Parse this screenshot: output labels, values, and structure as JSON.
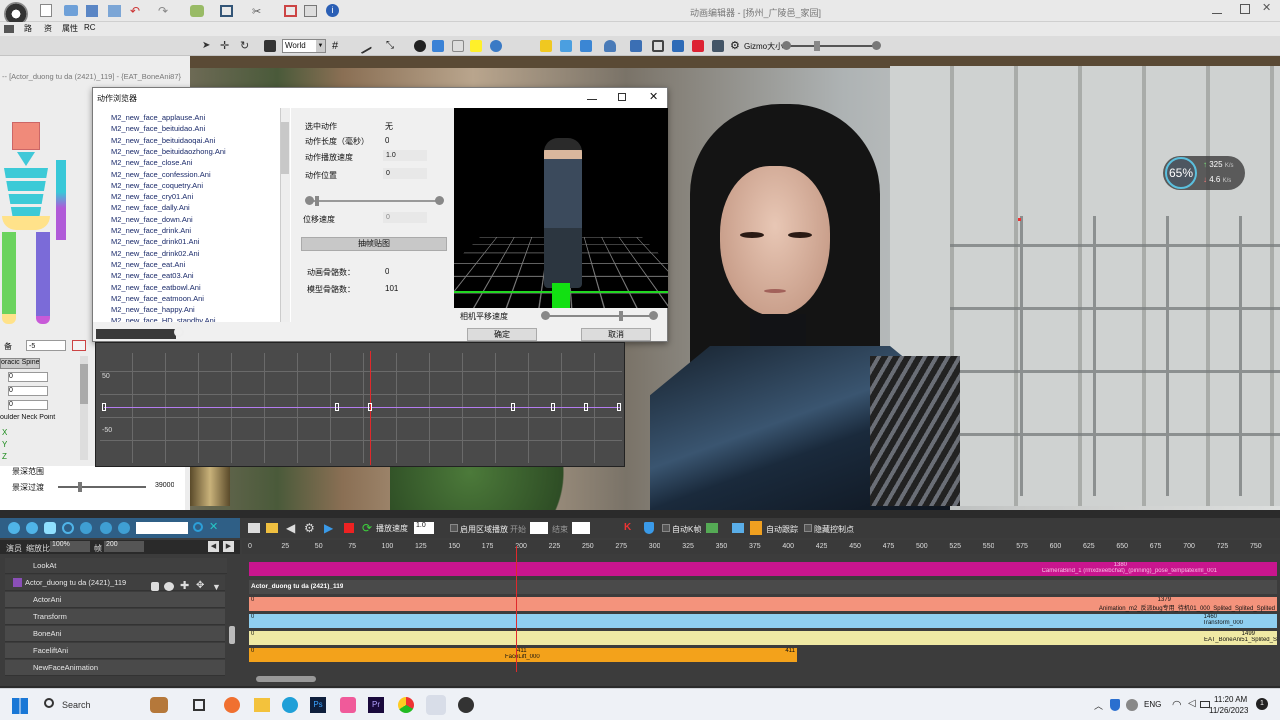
{
  "app": {
    "window_title": "动画编辑器 - [扬州_广陵邑_家园]",
    "second_row": [
      "路",
      "资",
      "属性",
      "RC"
    ],
    "subwindow_title": "-- [Actor_duong tu da (2421)_119] - {EAT_BoneAni87}"
  },
  "toolbar": {
    "space_select": "World",
    "gizmo_label": "Gizmo大小"
  },
  "browser": {
    "title": "动作浏览器",
    "items": [
      "M2_new_face_applause.Ani",
      "M2_new_face_beituidao.Ani",
      "M2_new_face_beituidaoqai.Ani",
      "M2_new_face_beituidaozhong.Ani",
      "M2_new_face_close.Ani",
      "M2_new_face_confession.Ani",
      "M2_new_face_coquetry.Ani",
      "M2_new_face_cry01.Ani",
      "M2_new_face_dally.Ani",
      "M2_new_face_down.Ani",
      "M2_new_face_drink.Ani",
      "M2_new_face_drink01.Ani",
      "M2_new_face_drink02.Ani",
      "M2_new_face_eat.Ani",
      "M2_new_face_eat03.Ani",
      "M2_new_face_eatbowl.Ani",
      "M2_new_face_eatmoon.Ani",
      "M2_new_face_happy.Ani",
      "M2_new_face_HD_standby.Ani"
    ],
    "props": {
      "selected_label": "选中动作",
      "selected_value": "无",
      "length_label": "动作长度（毫秒）",
      "length_value": "0",
      "speed_label": "动作播放速度",
      "speed_value": "1.0",
      "pos_label": "动作位置",
      "pos_value": "0",
      "displace_label": "位移速度",
      "displace_value": "0",
      "snapshot_button": "抽帧贴图",
      "anim_bones_label": "动画骨骼数：",
      "anim_bones_value": "0",
      "model_bones_label": "模型骨骼数：",
      "model_bones_value": "101"
    },
    "camera_speed_label": "相机平移速度",
    "ok_button": "确定",
    "cancel_button": "取消"
  },
  "leftpanel": {
    "field_label": "备",
    "field_value": "-5",
    "bone_a": "oracic Spine",
    "values": [
      "0",
      "0",
      "0"
    ],
    "bone_b": "oulder Neck Point",
    "axes": [
      "X",
      "Y",
      "Z"
    ],
    "slider_a_label": "景深范围",
    "slider_b_label": "景深过渡",
    "slider_b_value": "39000"
  },
  "curve": {
    "y_top": "50",
    "y_bottom": "-50"
  },
  "stats": {
    "percent": "65%",
    "up": "325",
    "up_unit": "K/s",
    "down": "4.6",
    "down_unit": "K/s"
  },
  "timeline": {
    "play_speed_label": "播放速度",
    "play_speed_value": "1.0",
    "range_label": "启用区域播放",
    "start_label": "开始",
    "end_label": "结束",
    "auto_frame_label": "自动K帧",
    "auto_follow_label": "自动跟踪",
    "hide_ctrl_label": "隐藏控制点",
    "scale_label": "演员",
    "zoom_label": "缩放比",
    "zoom_value": "100%",
    "frame_label": "帧",
    "frame_value": "200",
    "ticks": [
      "0",
      "25",
      "50",
      "75",
      "100",
      "125",
      "150",
      "175",
      "200",
      "225",
      "250",
      "275",
      "300",
      "325",
      "350",
      "375",
      "400",
      "425",
      "450",
      "475",
      "500",
      "525",
      "550",
      "575",
      "600",
      "625",
      "650",
      "675",
      "700",
      "725",
      "750"
    ],
    "tracks": [
      {
        "name": "LookAt",
        "indent": false
      },
      {
        "name": "Actor_duong tu da (2421)_119",
        "indent": false
      },
      {
        "name": "ActorAni",
        "indent": true
      },
      {
        "name": "Transform",
        "indent": true
      },
      {
        "name": "BoneAni",
        "indent": true
      },
      {
        "name": "FaceliftAni",
        "indent": true
      },
      {
        "name": "NewFaceAnimation",
        "indent": true
      }
    ],
    "clip_actor": "Actor_duong tu da (2421)_119",
    "clip_camera": "CameraBind_1 (rmxdxeebchat)_(pinning)_pose_templatexml_001",
    "clip_camera_end": "1380",
    "clip_anim": "Animation_m2_反派bug专用_待机01_000_Splited_Splited_Splited",
    "clip_anim_end": "1379",
    "clip_transform": "Transform_000",
    "clip_transform_end": "1460",
    "clip_bone": "EAT_BoneAni51_Splited_S",
    "clip_bone_end": "1499",
    "clip_face": "FaceLift_000",
    "clip_face_mid": "411",
    "clip_face_end": "411",
    "clip_start": "0"
  },
  "taskbar": {
    "search_placeholder": "Search",
    "lang": "ENG",
    "time": "11:20 AM",
    "date": "11/26/2023"
  },
  "colors": {
    "accent_magenta": "#c9158e",
    "clip_salmon": "#f4937c",
    "clip_blue": "#8fcff0",
    "clip_yellow": "#efe9a4",
    "clip_orange": "#f3a21b",
    "playhead": "#e0292b"
  }
}
